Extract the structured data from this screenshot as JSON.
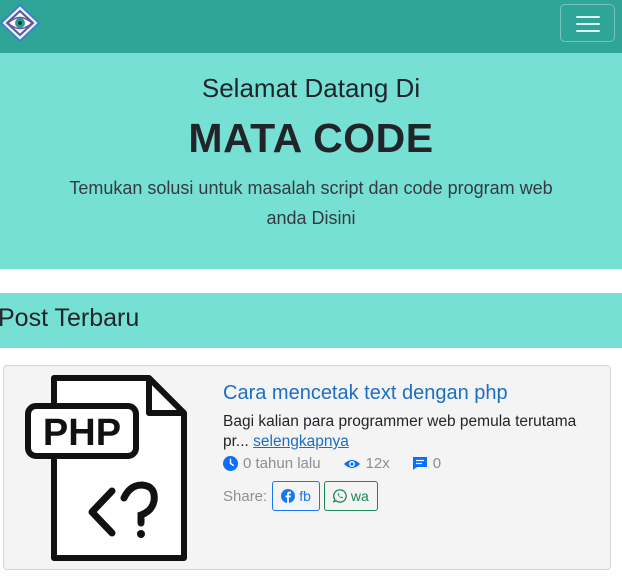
{
  "navbar": {
    "logo_icon": "eye-diamond-logo-icon",
    "toggler_icon": "hamburger-menu-icon"
  },
  "hero": {
    "subtitle": "Selamat Datang Di",
    "title": "MATA CODE",
    "description": "Temukan solusi untuk masalah script dan code program web anda Disini"
  },
  "section": {
    "title": "Post Terbaru"
  },
  "posts": [
    {
      "thumbnail_icon": "php-file-icon",
      "thumbnail_text": "PHP",
      "title": "Cara mencetak text dengan php",
      "excerpt": "Bagi kalian para programmer web pemula terutama pr...",
      "read_more": "selengkapnya",
      "time": "0 tahun lalu",
      "views": "12x",
      "comments": "0",
      "share_label": "Share:",
      "share_fb": "fb",
      "share_wa": "wa"
    }
  ],
  "colors": {
    "navbar": "#2ea597",
    "hero_bg": "#77e0d4",
    "link": "#1a6ec4",
    "facebook": "#1877f2",
    "whatsapp": "#198754"
  }
}
